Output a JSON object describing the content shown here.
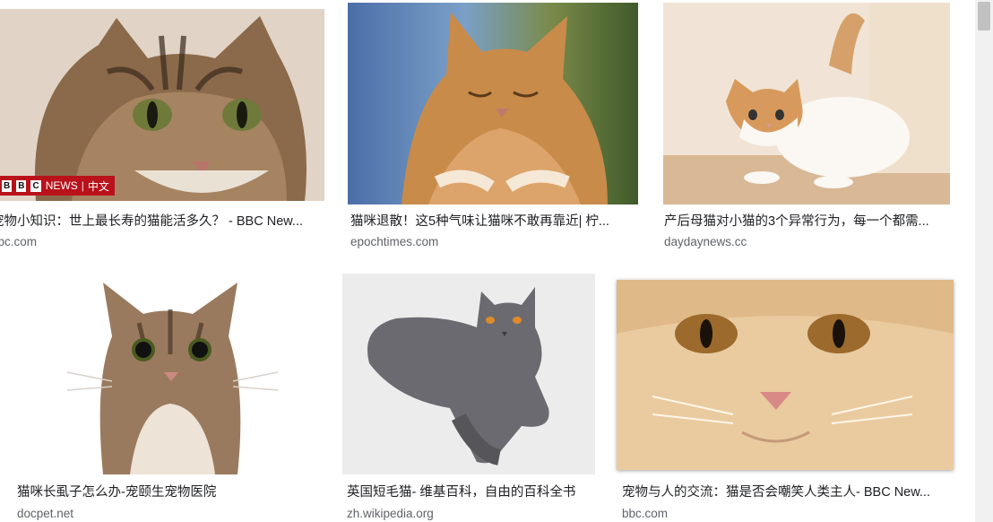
{
  "results": [
    {
      "title": "宠物小知识：世上最长寿的猫能活多久？ - BBC New...",
      "source": "bbc.com",
      "image": "tabby-cat-closeup",
      "badge": {
        "brand": [
          "B",
          "B",
          "C"
        ],
        "text": "NEWS",
        "sub": "中文"
      }
    },
    {
      "title": "猫咪退散！这5种气味让猫咪不敢再靠近| 柠...",
      "source": "epochtimes.com",
      "image": "orange-cat-sleeping"
    },
    {
      "title": "产后母猫对小猫的3个异常行为，每一个都需...",
      "source": "daydaynews.cc",
      "image": "orange-white-kitten"
    },
    {
      "title": "猫咪长虱子怎么办-宠颐生宠物医院",
      "source": "docpet.net",
      "image": "tabby-cat-portrait"
    },
    {
      "title": "英国短毛猫- 维基百科，自由的百科全书",
      "source": "zh.wikipedia.org",
      "image": "british-shorthair-gray-cat"
    },
    {
      "title": "宠物与人的交流：猫是否会嘲笑人类主人- BBC New...",
      "source": "bbc.com",
      "image": "cream-cat-face-closeup"
    }
  ],
  "colors": {
    "title": "#202124",
    "source": "#5f6368",
    "bbc_red": "#b9121b",
    "scrollbar_track": "#f1f1f1",
    "scrollbar_thumb": "#c1c1c1"
  }
}
